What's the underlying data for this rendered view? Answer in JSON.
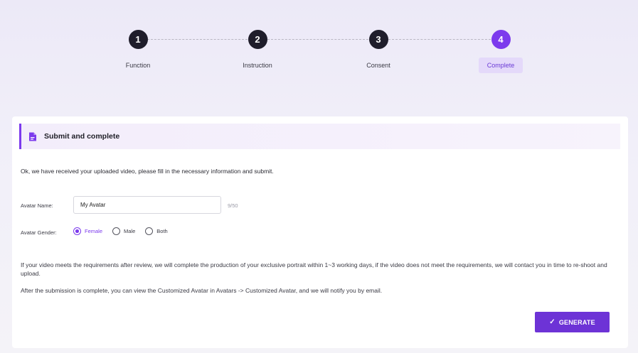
{
  "stepper": {
    "steps": [
      {
        "number": "1",
        "label": "Function"
      },
      {
        "number": "2",
        "label": "Instruction"
      },
      {
        "number": "3",
        "label": "Consent"
      },
      {
        "number": "4",
        "label": "Complete"
      }
    ],
    "active_step": 4
  },
  "section": {
    "title": "Submit and complete",
    "icon": "document-icon"
  },
  "intro_text": "Ok, we have received your uploaded video, please fill in the necessary information and submit.",
  "form": {
    "name_label": "Avatar Name:",
    "name_value": "My Avatar",
    "name_counter": "9/50",
    "gender_label": "Avatar Gender:",
    "gender_options": [
      {
        "label": "Female",
        "selected": true
      },
      {
        "label": "Male",
        "selected": false
      },
      {
        "label": "Both",
        "selected": false
      }
    ]
  },
  "notes": {
    "review": "If your video meets the requirements after review, we will complete the production of your exclusive portrait within 1~3 working days, if the video does not meet the requirements, we will contact you in time to re-shoot and upload.",
    "after_submit": "After the submission is complete, you can view the Customized Avatar in Avatars -> Customized Avatar, and we will notify you by email."
  },
  "generate_button": {
    "label": "GENERATE",
    "icon": "check-icon"
  },
  "colors": {
    "accent": "#7c3aed",
    "button": "#6d33d6",
    "step_inactive": "#1f1d2b"
  }
}
